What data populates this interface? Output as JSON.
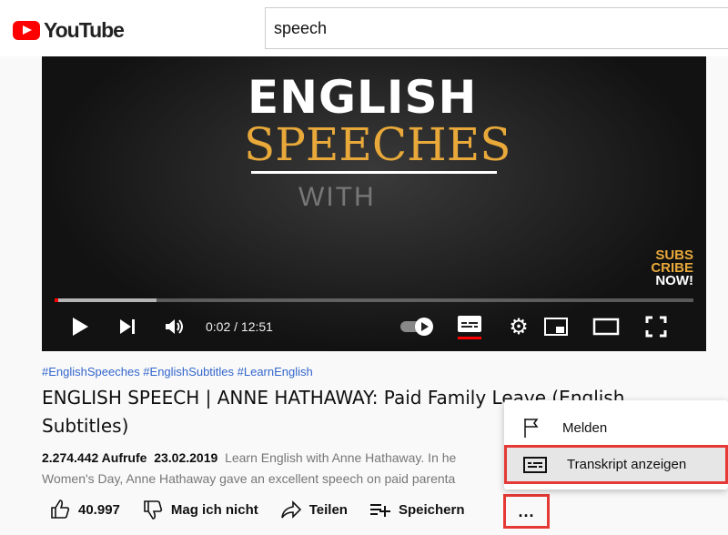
{
  "header": {
    "logo_text": "YouTube",
    "search_value": "speech"
  },
  "video": {
    "thumb_line1": "ENGLISH",
    "thumb_line2": "SPEECHES",
    "thumb_line3": "WITH",
    "thumb_badge": [
      "SUBS",
      "CRIBE",
      "NOW!"
    ],
    "time": "0:02 / 12:51",
    "played_percent": 0.3,
    "buffered_percent": 16
  },
  "tags": "#EnglishSpeeches #EnglishSubtitles #LearnEnglish",
  "title": "ENGLISH SPEECH | ANNE HATHAWAY: Paid Family Leave (English Subtitles)",
  "meta": {
    "views": "2.274.442 Aufrufe",
    "date": "23.02.2019",
    "desc_line1": "Learn English with Anne Hathaway. In he",
    "desc_line2": "Women's Day, Anne Hathaway gave an excellent speech on paid parenta"
  },
  "actions": {
    "likes": "40.997",
    "dislike": "Mag ich nicht",
    "share": "Teilen",
    "save": "Speichern",
    "more": "..."
  },
  "menu": {
    "report": "Melden",
    "transcript": "Transkript anzeigen"
  },
  "colors": {
    "highlight": "#e53935",
    "link": "#3366cc",
    "brand": "#ff0000"
  }
}
